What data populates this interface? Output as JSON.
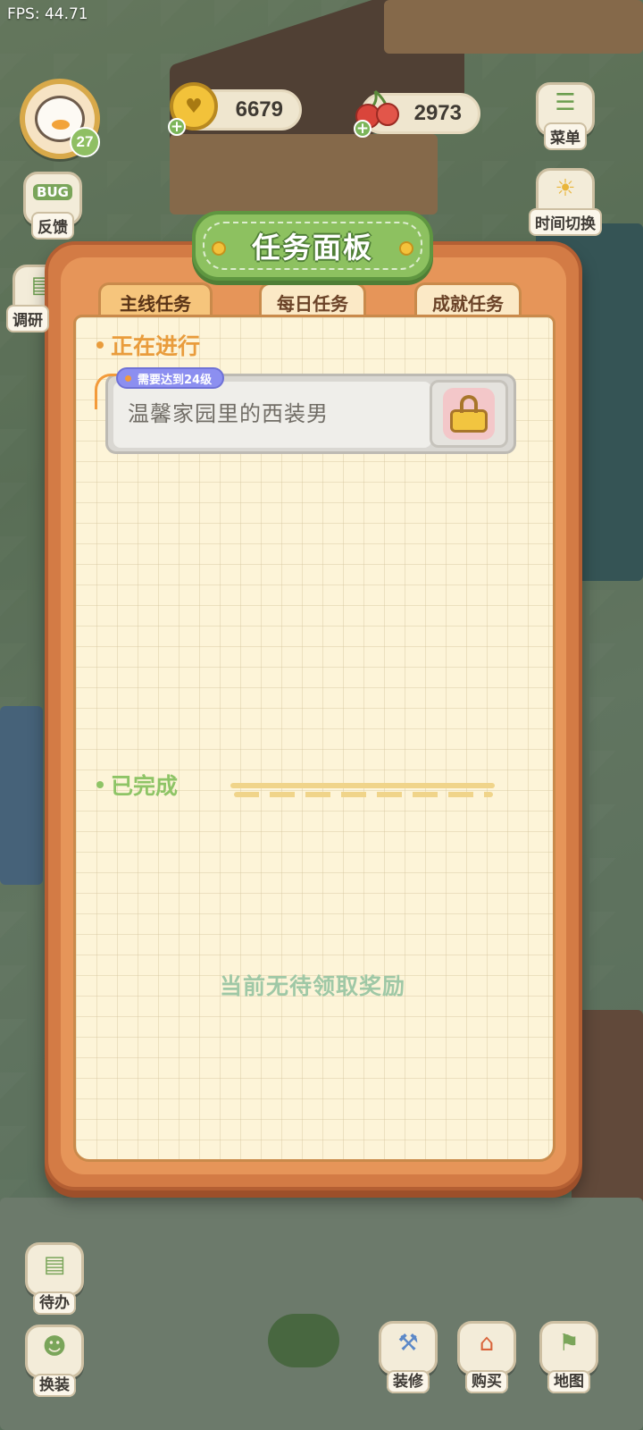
{
  "debug": {
    "fps": "FPS: 44.71"
  },
  "player": {
    "level": "27"
  },
  "currencies": {
    "gold": "6679",
    "cherry": "2973"
  },
  "side_left": [
    {
      "label": "反馈",
      "badge": "BUG",
      "icon": "bug-icon"
    },
    {
      "label": "调研",
      "icon": "clipboard-icon"
    }
  ],
  "side_right": [
    {
      "label": "菜单",
      "icon": "menu-icon"
    },
    {
      "label": "时间切换",
      "icon": "sun-moon-icon"
    }
  ],
  "panel": {
    "title": "任务面板",
    "tabs": [
      {
        "label": "主线任务",
        "active": true
      },
      {
        "label": "每日任务",
        "active": false
      },
      {
        "label": "成就任务",
        "active": false
      }
    ],
    "in_progress_label": "正在进行",
    "task": {
      "requirement": "需要达到24级",
      "name": "温馨家园里的西装男",
      "state_icon": "lock-icon"
    },
    "completed_label": "已完成",
    "empty_note": "当前无待领取奖励"
  },
  "bottom_buttons": [
    {
      "label": "待办",
      "icon": "todo-list-icon"
    },
    {
      "label": "换装",
      "icon": "outfit-icon"
    },
    {
      "label": "装修",
      "icon": "decorate-icon"
    },
    {
      "label": "购买",
      "icon": "shop-icon"
    },
    {
      "label": "地图",
      "icon": "map-icon"
    }
  ],
  "colors": {
    "panel_frame": "#d37b45",
    "title_green": "#8dc160",
    "progress_orange": "#e99c3c",
    "done_green": "#8ec466",
    "requirement_purple": "#8c8ff0"
  }
}
